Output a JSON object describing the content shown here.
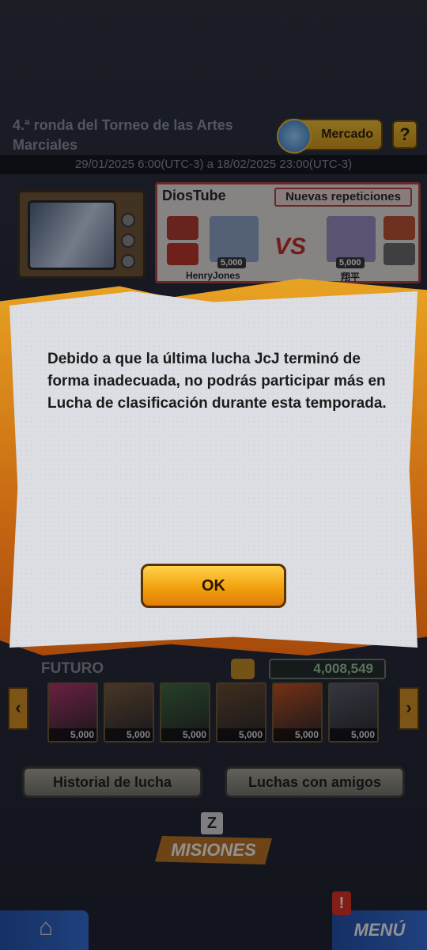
{
  "header": {
    "title": "4.ª ronda del Torneo de las Artes Marciales",
    "market_label": "Mercado",
    "help_label": "?",
    "dates": "29/01/2025 6:00(UTC-3) a 18/02/2025 23:00(UTC-3)"
  },
  "diostube": {
    "title": "DiosTube",
    "replays_label": "Nuevas repeticiones",
    "vs_label": "VS",
    "left_player": {
      "name": "HenryJones",
      "level": "5,000"
    },
    "right_player": {
      "name": "翔平",
      "level": "5,000"
    }
  },
  "modal": {
    "message": "Debido a que la última lucha JcJ terminó de forma inadecuada, no podrás participar más en Lucha de clasificación durante esta temporada.",
    "ok_label": "OK"
  },
  "team": {
    "name": "FUTURO",
    "power": "4,008,549",
    "cards": [
      {
        "level": "5,000",
        "color": "#b8326b"
      },
      {
        "level": "5,000",
        "color": "#7a5a3a"
      },
      {
        "level": "5,000",
        "color": "#3c6a3a"
      },
      {
        "level": "5,000",
        "color": "#6a4a2a"
      },
      {
        "level": "5,000",
        "color": "#c8501a"
      },
      {
        "level": "5,000",
        "color": "#5a5a6a"
      }
    ],
    "left_arrow": "‹",
    "right_arrow": "›"
  },
  "buttons": {
    "history_label": "Historial de lucha",
    "friends_label": "Luchas con amigos",
    "missions_label": "MISIONES",
    "missions_z": "Z",
    "home_icon": "⌂",
    "menu_label": "MENÚ",
    "menu_alert": "!"
  }
}
